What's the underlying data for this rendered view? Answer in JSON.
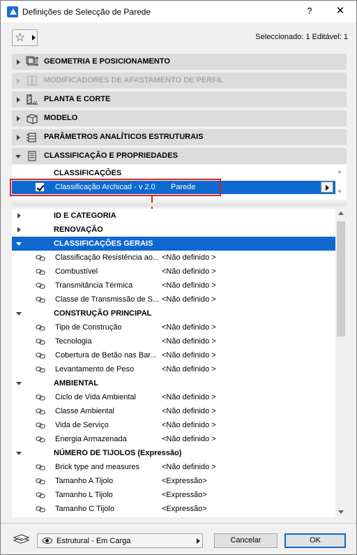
{
  "window": {
    "title": "Definições de Selecção de Parede",
    "help": "?",
    "close": "✕"
  },
  "toolbar": {
    "selection_info": "Seleccionado: 1 Editável: 1"
  },
  "panels": [
    {
      "label": "GEOMETRIA E POSICIONAMENTO",
      "enabled": true,
      "expanded": false
    },
    {
      "label": "MODIFICADORES DE AFASTAMENTO DE PERFIL",
      "enabled": false,
      "expanded": false
    },
    {
      "label": "PLANTA E CORTE",
      "enabled": true,
      "expanded": false
    },
    {
      "label": "MODELO",
      "enabled": true,
      "expanded": false
    },
    {
      "label": "PARÂMETROS ANALÍTICOS ESTRUTURAIS",
      "enabled": true,
      "expanded": false
    },
    {
      "label": "CLASSIFICAÇÃO E PROPRIEDADES",
      "enabled": true,
      "expanded": true
    }
  ],
  "classifications": {
    "header": "CLASSIFICAÇÕES",
    "row": {
      "system": "Classificação Archicad - v 2.0",
      "value": "Parede",
      "checked": true
    }
  },
  "properties": {
    "rows": [
      {
        "kind": "group",
        "label": "ID E CATEGORIA",
        "expanded": false
      },
      {
        "kind": "group",
        "label": "RENOVAÇÃO",
        "expanded": false
      },
      {
        "kind": "group",
        "label": "CLASSIFICAÇÕES GERAIS",
        "expanded": true,
        "selected": true
      },
      {
        "kind": "prop",
        "name": "Classificação Resistência ao...",
        "value": "<Não definido >"
      },
      {
        "kind": "prop",
        "name": "Combustível",
        "value": "<Não definido >"
      },
      {
        "kind": "prop",
        "name": "Transmitância Térmica",
        "value": "<Não definido >"
      },
      {
        "kind": "prop",
        "name": "Classe de Transmissão de S...",
        "value": "<Não definido >"
      },
      {
        "kind": "group",
        "label": "CONSTRUÇÃO PRINCIPAL",
        "expanded": true
      },
      {
        "kind": "prop",
        "name": "Tipo de Construção",
        "value": "<Não definido >"
      },
      {
        "kind": "prop",
        "name": "Tecnologia",
        "value": "<Não definido >"
      },
      {
        "kind": "prop",
        "name": "Cobertura de Betão nas Bar...",
        "value": "<Não definido >"
      },
      {
        "kind": "prop",
        "name": "Levantamento de Peso",
        "value": "<Não definido >"
      },
      {
        "kind": "group",
        "label": "AMBIENTAL",
        "expanded": true
      },
      {
        "kind": "prop",
        "name": "Ciclo de Vida Ambiental",
        "value": "<Não definido >"
      },
      {
        "kind": "prop",
        "name": "Classe Ambiental",
        "value": "<Não definido >"
      },
      {
        "kind": "prop",
        "name": "Vida de Serviço",
        "value": "<Não definido >"
      },
      {
        "kind": "prop",
        "name": "Energia Armazenada",
        "value": "<Não definido >"
      },
      {
        "kind": "group",
        "label": "NÚMERO DE TIJOLOS (Expressão)",
        "expanded": true
      },
      {
        "kind": "prop",
        "name": "Brick type and measures",
        "value": "<Não definido >"
      },
      {
        "kind": "prop",
        "name": "Tamanho A Tijolo",
        "value": "<Expressão>"
      },
      {
        "kind": "prop",
        "name": "Tamanho L Tijolo",
        "value": "<Expressão>"
      },
      {
        "kind": "prop",
        "name": "Tamanho C Tijolo",
        "value": "<Expressão>"
      }
    ]
  },
  "footer": {
    "layer": "Estrutural - Em Carga",
    "cancel": "Cancelar",
    "ok": "OK"
  },
  "colors": {
    "selection": "#0e69cf",
    "highlight_annotation": "#e11d1d"
  }
}
